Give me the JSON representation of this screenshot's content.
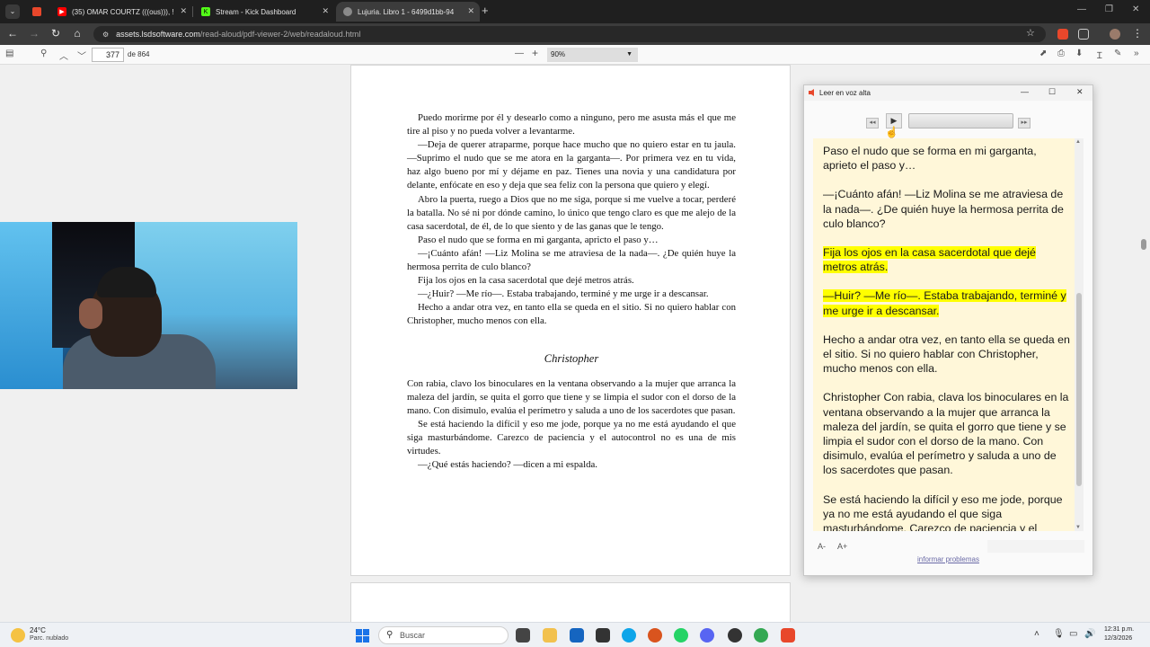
{
  "browser": {
    "tabs": [
      {
        "label": "",
        "color": "#e8472b"
      },
      {
        "label": "(35) OMAR COURTZ (((ous))), !",
        "color": "#ff0000"
      },
      {
        "label": "Stream - Kick Dashboard",
        "color": "#53fc18"
      },
      {
        "label": "Lujuria. Libro 1 - 6499d1bb-94",
        "color": "#bdbdbd"
      }
    ],
    "url_host": "assets.lsdsoftware.com",
    "url_path": "/read-aloud/pdf-viewer-2/web/readaloud.html"
  },
  "pdf_toolbar": {
    "page_number": "377",
    "page_count": "de 864",
    "zoom": "90%"
  },
  "document": {
    "paragraphs_before": [
      "Puedo morirme por él y desearlo como a ninguno, pero me asusta más el que me tire al piso y no pueda volver a levantarme.",
      "—Deja de querer atraparme, porque hace mucho que no quiero estar en tu jaula. —Suprimo el nudo que se me atora en la garganta—. Por primera vez en tu vida, haz algo bueno por mí y déjame en paz. Tienes una novia y una candidatura por delante, enfócate en eso y deja que sea feliz con la persona que quiero y elegí.",
      "Abro la puerta, ruego a Dios que no me siga, porque si me vuelve a tocar, perderé la batalla. No sé ni por dónde camino, lo único que tengo claro es que me alejo de la casa sacerdotal, de él, de lo que siento y de las ganas que le tengo.",
      "Paso el nudo que se forma en mi garganta, apricto el paso y…",
      "—¡Cuánto afán! —Liz Molina se me atraviesa de la nada—. ¿De quién huye la hermosa perrita de culo blanco?",
      "Fija los ojos en la casa sacerdotal que dejé metros atrás.",
      "—¿Huir? —Me río—. Estaba trabajando, terminé y me urge ir a descansar.",
      "Hecho a andar otra vez, en tanto ella se queda en el sitio. Si no quiero hablar con Christopher, mucho menos con ella."
    ],
    "heading": "Christopher",
    "paragraphs_after": [
      "Con rabia, clavo los binoculares en la ventana observando a la mujer que arranca la maleza del jardín, se quita el gorro que tiene y se limpia el sudor con el dorso de la mano. Con disimulo, evalúa el perímetro y saluda a uno de los sacerdotes que pasan.",
      "Se está haciendo la difícil y eso me jode, porque ya no me está ayudando el que siga masturbándome. Carezco de paciencia y el autocontrol no es una de mis virtudes.",
      "—¿Qué estás haciendo? —dicen a mi espalda."
    ]
  },
  "read_aloud": {
    "title": "Leer en voz alta",
    "paragraphs": [
      {
        "text": "Paso el nudo que se forma en mi garganta, aprieto el paso y…",
        "highlight": false
      },
      {
        "text": "—¡Cuánto afán! —Liz Molina se me atraviesa de la nada—. ¿De quién huye la hermosa perrita de culo blanco?",
        "highlight": false
      },
      {
        "text": "Fija los ojos en la casa sacerdotal que dejé metros atrás.",
        "highlight": true
      },
      {
        "text": "—Huir? —Me río—. Estaba trabajando, terminé y me urge ir a descansar.",
        "highlight": true
      },
      {
        "text": "Hecho a andar otra vez, en tanto ella se queda en el sitio. Si no quiero hablar con Christopher, mucho menos con ella.",
        "highlight": false
      },
      {
        "text": "Christopher Con rabia, clava los binoculares en la ventana observando a la mujer que arranca la maleza del jardín, se quita el gorro que tiene y se limpia el sudor con el dorso de la mano. Con disimulo, evalúa el perímetro y saluda a uno de los sacerdotes que pasan.",
        "highlight": false
      },
      {
        "text": "Se está haciendo la difícil y eso me jode, porque ya no me está ayudando el que siga masturbándome. Carezco de paciencia y el autocontrol no es una de mis virtudes.",
        "highlight": false
      }
    ],
    "font_smaller": "A-",
    "font_larger": "A+",
    "report_link": "informar problemas",
    "highlight_color": "#ffff00",
    "background_color": "#fff7d9"
  },
  "taskbar": {
    "temperature": "24°C",
    "weather": "Parc. nublado",
    "search_placeholder": "Buscar",
    "time": "12:31 p.m.",
    "date": "12/3/2026"
  }
}
